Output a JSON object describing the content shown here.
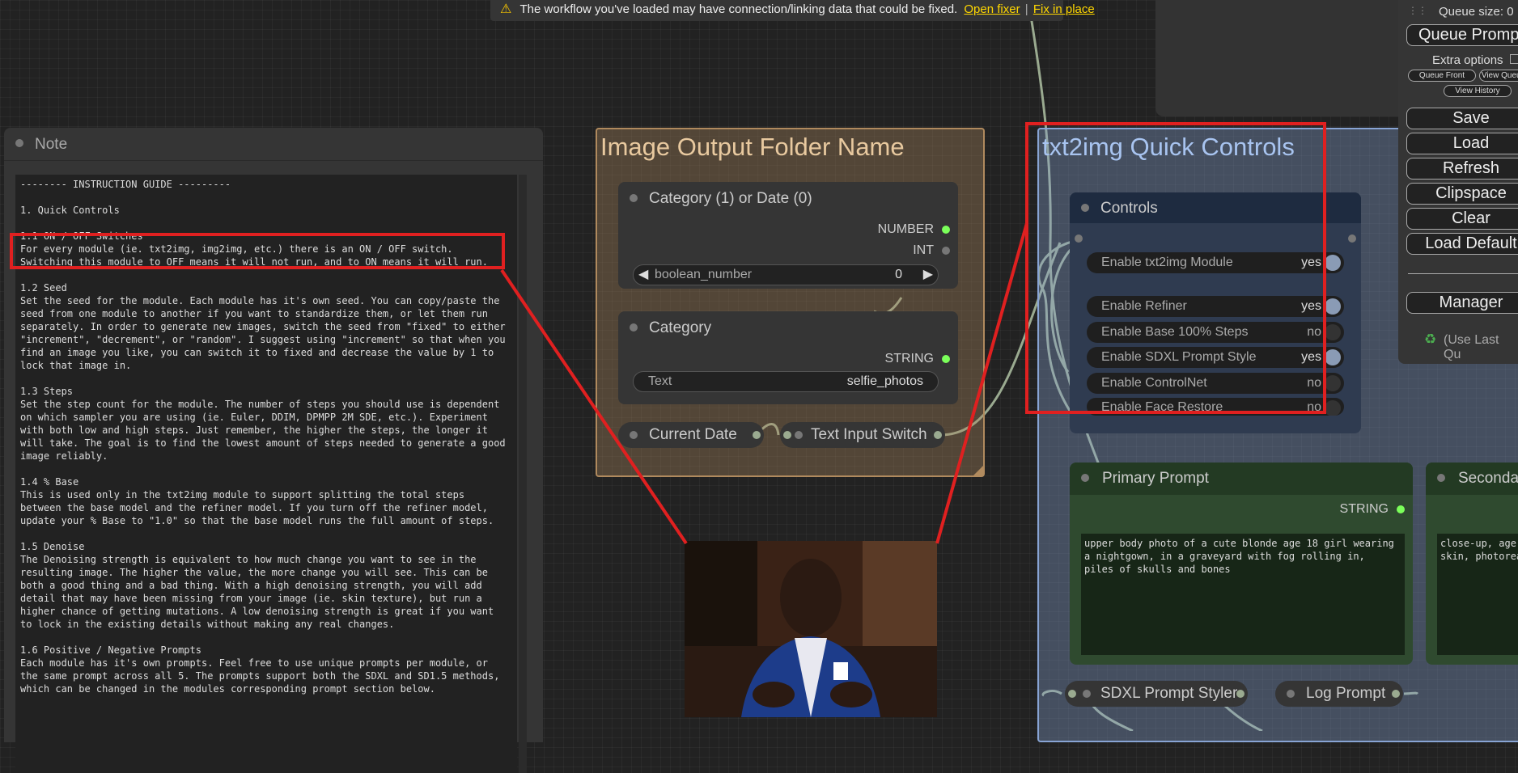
{
  "notification": {
    "message": "The workflow you've loaded may have connection/linking data that could be fixed.",
    "link_open_fixer": "Open fixer",
    "separator": "|",
    "link_fix_in_place": "Fix in place"
  },
  "note_node": {
    "title": "Note",
    "text": "-------- INSTRUCTION GUIDE ---------\n\n1. Quick Controls\n\n1.1 ON / OFF Switches\nFor every module (ie. txt2img, img2img, etc.) there is an ON / OFF switch.\nSwitching this module to OFF means it will not run, and to ON means it will run.\n\n1.2 Seed\nSet the seed for the module. Each module has it's own seed. You can copy/paste the\nseed from one module to another if you want to standardize them, or let them run\nseparately. In order to generate new images, switch the seed from \"fixed\" to either\n\"increment\", \"decrement\", or \"random\". I suggest using \"increment\" so that when you\nfind an image you like, you can switch it to fixed and decrease the value by 1 to\nlock that image in.\n\n1.3 Steps\nSet the step count for the module. The number of steps you should use is dependent\non which sampler you are using (ie. Euler, DDIM, DPMPP 2M SDE, etc.). Experiment\nwith both low and high steps. Just remember, the higher the steps, the longer it\nwill take. The goal is to find the lowest amount of steps needed to generate a good\nimage reliably.\n\n1.4 % Base\nThis is used only in the txt2img module to support splitting the total steps\nbetween the base model and the refiner model. If you turn off the refiner model,\nupdate your % Base to \"1.0\" so that the base model runs the full amount of steps.\n\n1.5 Denoise\nThe Denoising strength is equivalent to how much change you want to see in the\nresulting image. The higher the value, the more change you will see. This can be\nboth a good thing and a bad thing. With a high denoising strength, you will add\ndetail that may have been missing from your image (ie. skin texture), but run a\nhigher chance of getting mutations. A low denoising strength is great if you want\nto lock in the existing details without making any real changes.\n\n1.6 Positive / Negative Prompts\nEach module has it's own prompts. Feel free to use unique prompts per module, or\nthe same prompt across all 5. The prompts support both the SDXL and SD1.5 methods,\nwhich can be changed in the modules corresponding prompt section below."
  },
  "image_output_group": {
    "title": "Image Output Folder Name",
    "category_switch_node": {
      "title": "Category (1) or Date (0)",
      "outputs": [
        "NUMBER",
        "INT"
      ],
      "widget_label": "boolean_number",
      "widget_value": "0"
    },
    "category_node": {
      "title": "Category",
      "output": "STRING",
      "widget_label": "Text",
      "widget_value": "selfie_photos"
    },
    "current_date_node": {
      "title": "Current Date"
    },
    "text_input_switch_node": {
      "title": "Text Input Switch"
    }
  },
  "quick_controls_group": {
    "title": "txt2img Quick Controls",
    "controls_node": {
      "title": "Controls",
      "rows": [
        {
          "label": "Enable txt2img Module",
          "value": "yes"
        },
        {
          "label": "Enable Refiner",
          "value": "yes"
        },
        {
          "label": "Enable Base 100% Steps",
          "value": "no"
        },
        {
          "label": "Enable SDXL Prompt Style",
          "value": "yes"
        },
        {
          "label": "Enable ControlNet",
          "value": "no"
        },
        {
          "label": "Enable Face Restore",
          "value": "no"
        }
      ]
    },
    "primary_prompt_node": {
      "title": "Primary Prompt",
      "output": "STRING",
      "text": "upper body photo of a cute blonde age 18 girl wearing\na nightgown, in a graveyard with fog rolling in,\npiles of skulls and bones"
    },
    "secondary_prompt_node": {
      "title": "Seconda",
      "text": "close-up, age\nskin, photorea"
    },
    "sdxl_prompt_styler_node": {
      "title": "SDXL Prompt Styler"
    },
    "log_prompt_node": {
      "title": "Log Prompt"
    }
  },
  "side_menu": {
    "queue_size": "Queue size: 0",
    "queue_prompt": "Queue Prompt",
    "extra_options": "Extra options",
    "queue_front": "Queue Front",
    "view_queue": "View Queue",
    "view_history": "View History",
    "save": "Save",
    "load": "Load",
    "refresh": "Refresh",
    "clipspace": "Clipspace",
    "clear": "Clear",
    "load_default": "Load Default",
    "manager": "Manager",
    "use_last_queue": "(Use Last Qu"
  },
  "colors": {
    "highlight_red": "#e02020",
    "group_tan": "#b08a5e",
    "group_blue": "#88a4d4",
    "link_green": "#9aaa90",
    "slot_green": "#7bff5a"
  }
}
